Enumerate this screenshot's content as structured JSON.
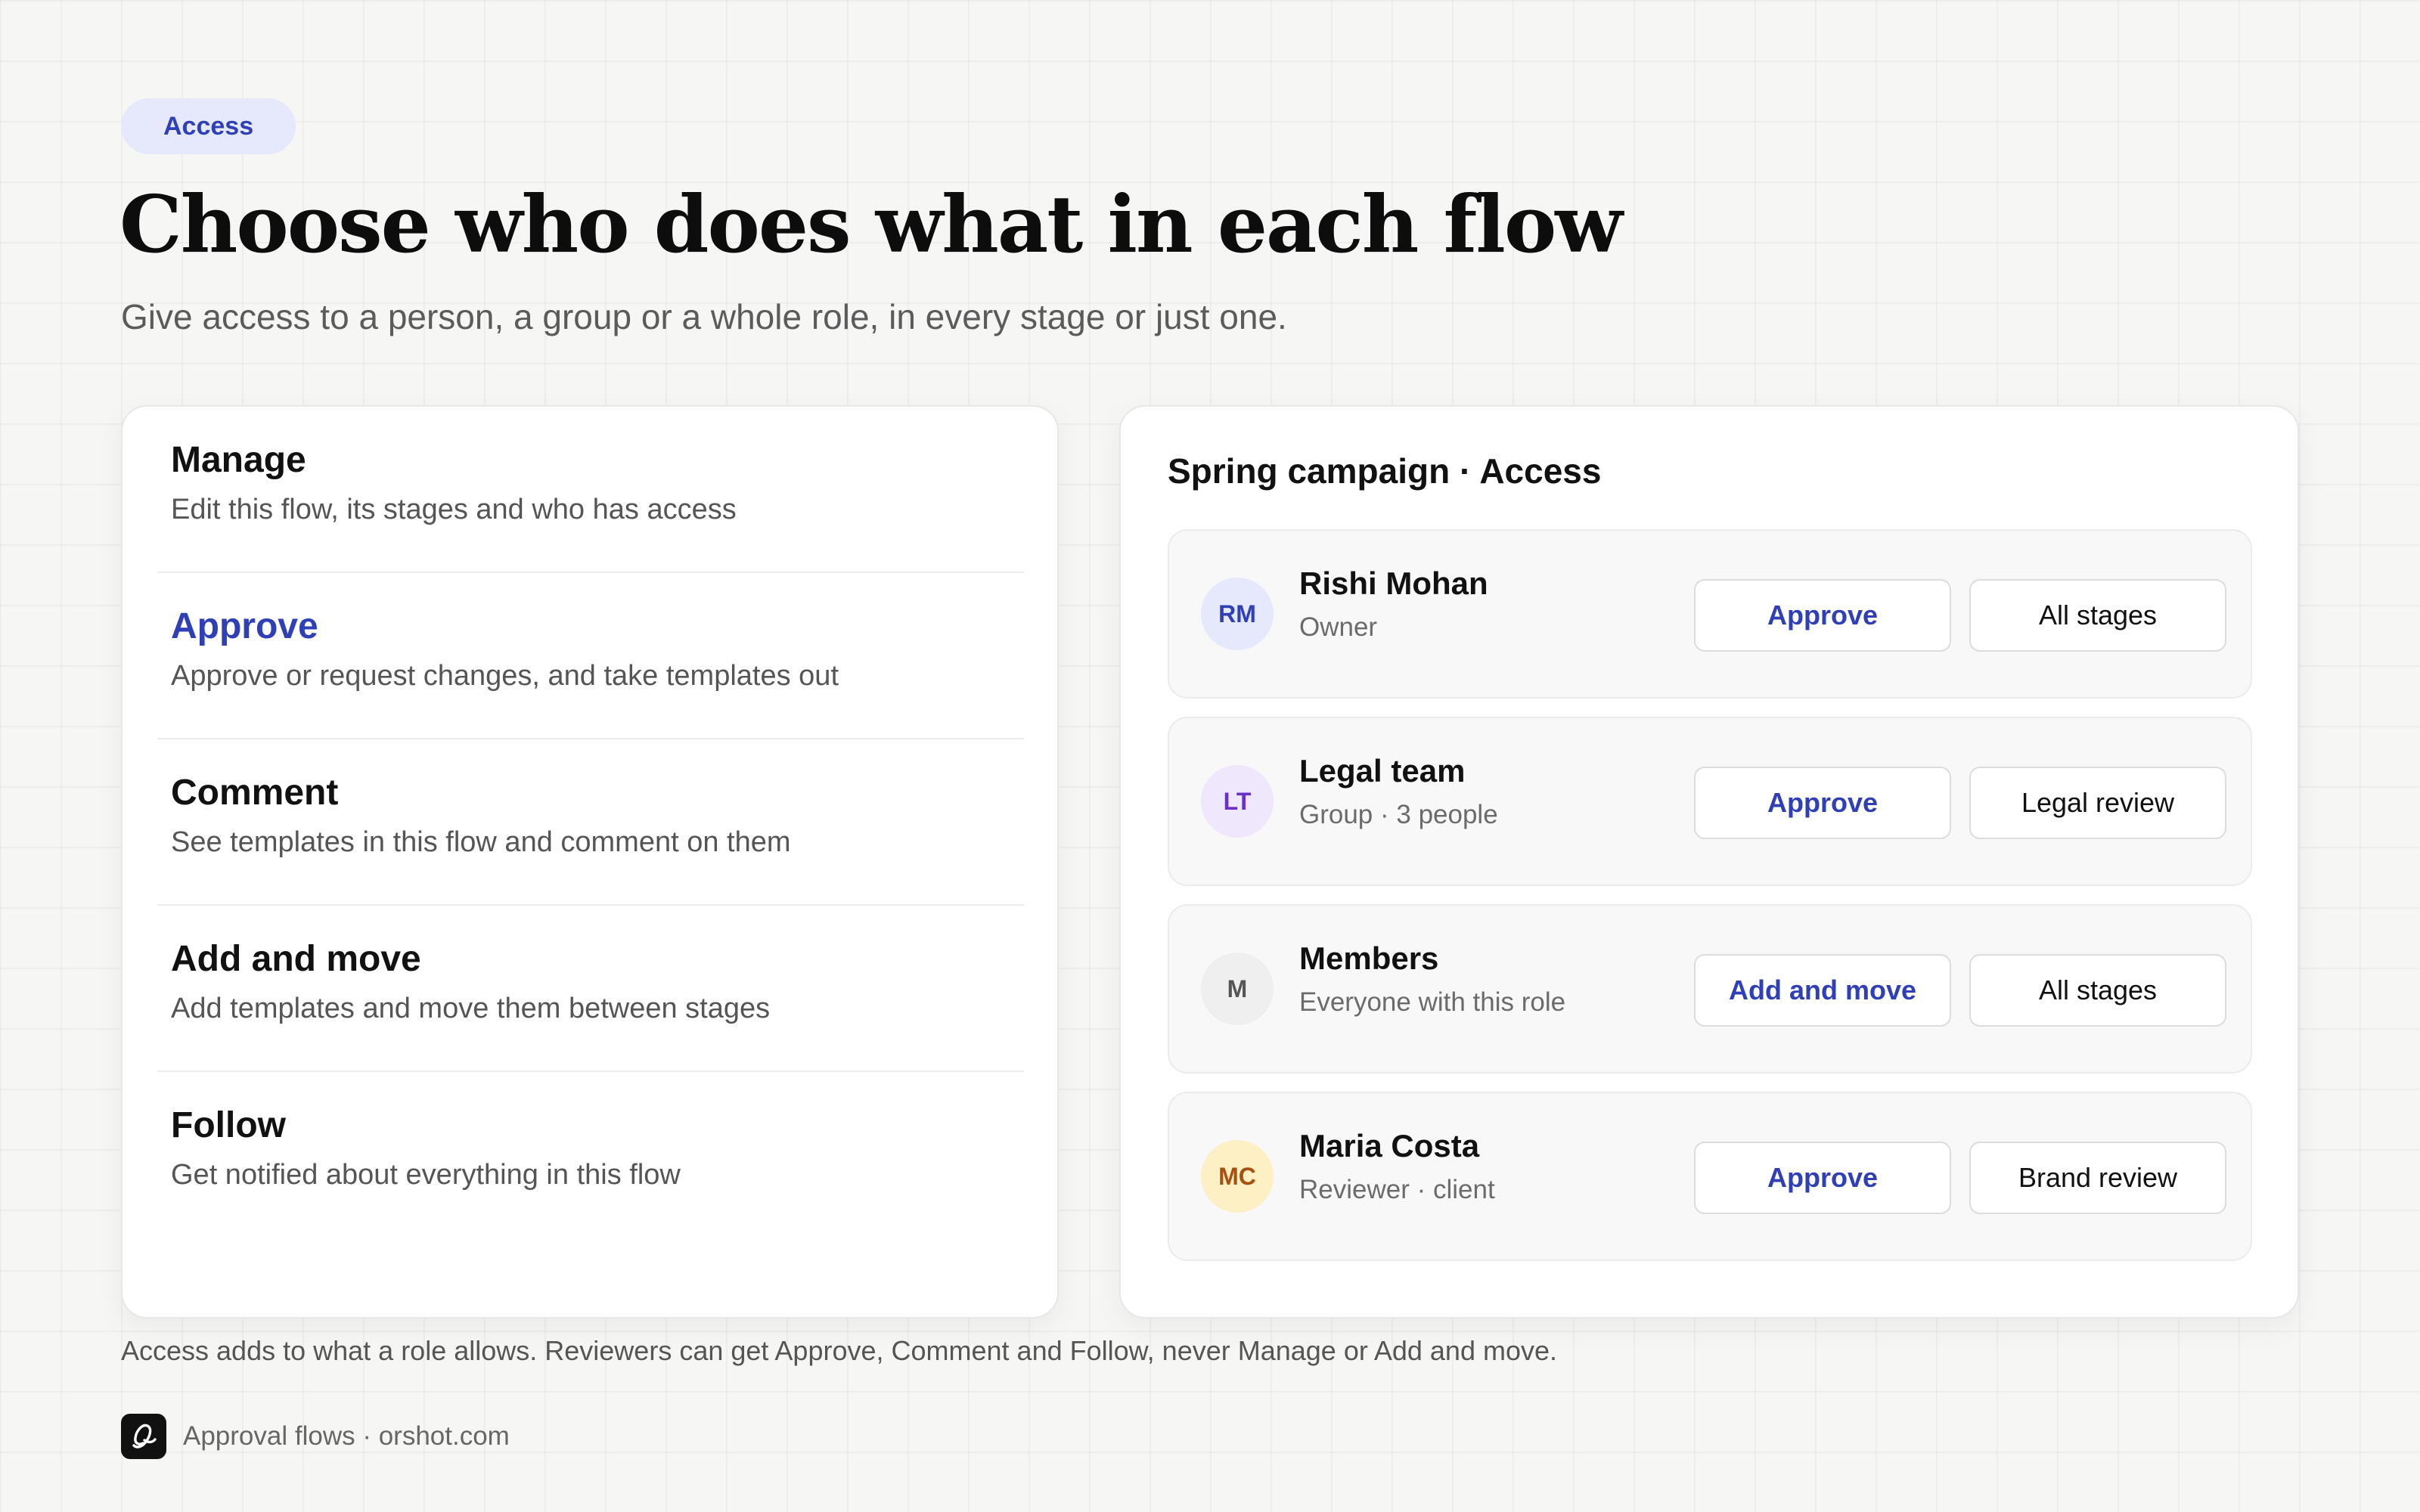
{
  "badge": "Access",
  "title": "Choose who does what in each flow",
  "subtitle": "Give access to a person, a group or a whole role, in every stage or just one.",
  "permissions": [
    {
      "title": "Manage",
      "description": "Edit this flow, its stages and who has access"
    },
    {
      "title": "Approve",
      "description": "Approve or request changes, and take templates out"
    },
    {
      "title": "Comment",
      "description": "See templates in this flow and comment on them"
    },
    {
      "title": "Add and move",
      "description": "Add templates and move them between stages"
    },
    {
      "title": "Follow",
      "description": "Get notified about everything in this flow"
    }
  ],
  "panel": {
    "title": "Spring campaign · Access",
    "rows": [
      {
        "initials": "RM",
        "name": "Rishi Mohan",
        "subtitle": "Owner",
        "permission": "Approve",
        "stage": "All stages",
        "avatar_bg": "#e6e8fb",
        "avatar_fg": "#2f3fb8"
      },
      {
        "initials": "LT",
        "name": "Legal team",
        "subtitle": "Group · 3 people",
        "permission": "Approve",
        "stage": "Legal review",
        "avatar_bg": "#efe8fd",
        "avatar_fg": "#6a31c8"
      },
      {
        "initials": "M",
        "name": "Members",
        "subtitle": "Everyone with this role",
        "permission": "Add and move",
        "stage": "All stages",
        "avatar_bg": "#efefef",
        "avatar_fg": "#555555"
      },
      {
        "initials": "MC",
        "name": "Maria Costa",
        "subtitle": "Reviewer · client",
        "permission": "Approve",
        "stage": "Brand review",
        "avatar_bg": "#fdf0c4",
        "avatar_fg": "#a8500f"
      }
    ]
  },
  "footnote": "Access adds to what a role allows. Reviewers can get Approve, Comment and Follow, never Manage or Add and move.",
  "brand": {
    "text": "Approval flows · orshot.com",
    "icon": "orshot-logo-icon"
  },
  "colors": {
    "accent": "#2f3fb8",
    "badge_bg": "#e6e8fb",
    "background": "#f6f6f5"
  }
}
